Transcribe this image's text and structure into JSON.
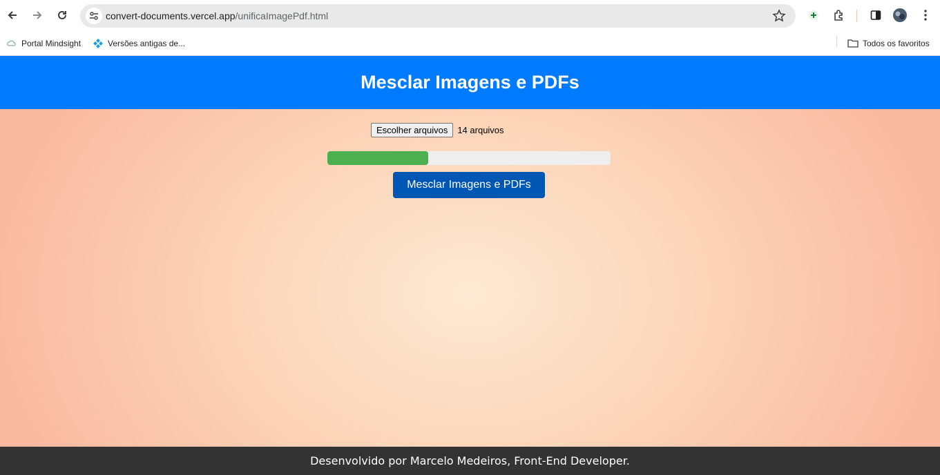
{
  "browser": {
    "url_host": "convert-documents.vercel.app",
    "url_path": "/unificaImagePdf.html",
    "bookmarks": [
      {
        "label": "Portal Mindsight",
        "icon": "cloud-icon"
      },
      {
        "label": "Versões antigas de...",
        "icon": "diamond-logo-icon"
      }
    ],
    "all_bookmarks_label": "Todos os favoritos"
  },
  "header": {
    "title": "Mesclar Imagens e PDFs"
  },
  "upload": {
    "button_label": "Escolher arquivos",
    "status": "14 arquivos"
  },
  "progress": {
    "value_percent": 35.6
  },
  "actions": {
    "merge_label": "Mesclar Imagens e PDFs"
  },
  "footer": {
    "text": "Desenvolvido por Marcelo Medeiros, Front-End Developer."
  },
  "colors": {
    "header_bg": "#007bff",
    "button_bg": "#0056b3",
    "progress_fill": "#4caf50",
    "footer_bg": "#333333"
  }
}
